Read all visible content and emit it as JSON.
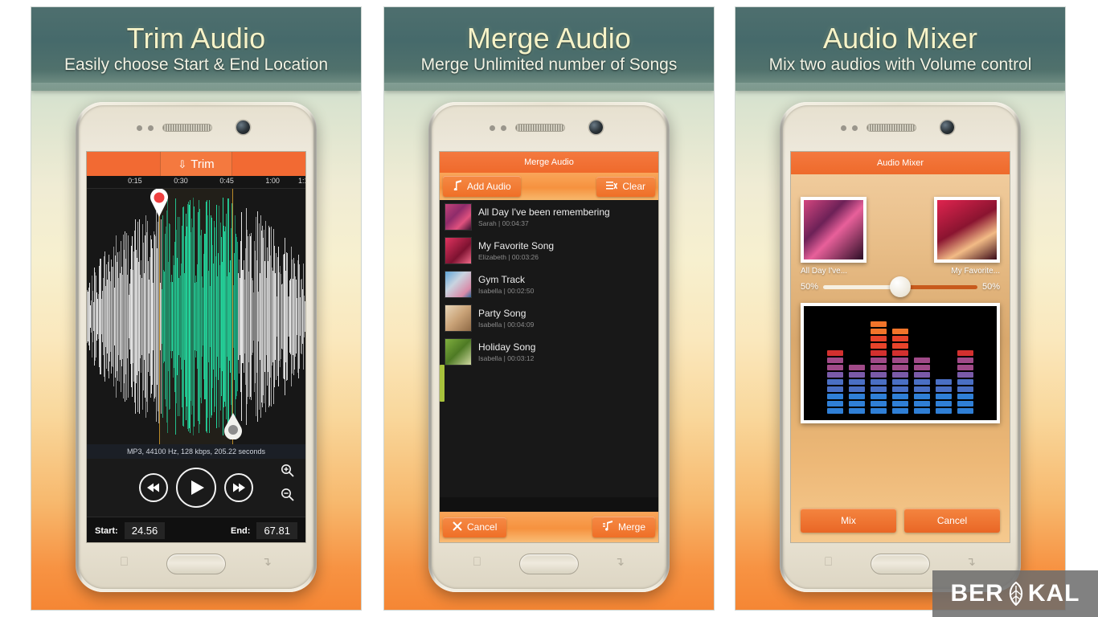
{
  "panels": [
    {
      "banner": {
        "title": "Trim Audio",
        "subtitle": "Easily choose Start & End Location"
      },
      "screen": {
        "trim_button_label": "Trim",
        "trim_icon": "collapse-arrows-icon",
        "ruler_labels": [
          "0:15",
          "0:30",
          "0:45",
          "1:00",
          "1:1"
        ],
        "meta": "MP3, 44100 Hz, 128 kbps, 205.22 seconds",
        "controls": {
          "rewind_label": "◀◀",
          "play_label": "▶",
          "forward_label": "▶▶",
          "zoom_in_label": "⊕",
          "zoom_out_label": "⊖"
        },
        "start_label": "Start:",
        "start_value": "24.56",
        "end_label": "End:",
        "end_value": "67.81"
      }
    },
    {
      "banner": {
        "title": "Merge Audio",
        "subtitle": "Merge Unlimited number of Songs"
      },
      "screen": {
        "title": "Merge Audio",
        "add_label": "Add Audio",
        "add_icon": "music-note-icon",
        "clear_label": "Clear",
        "clear_icon": "list-clear-icon",
        "songs": [
          {
            "name": "All Day I've been remembering",
            "artist": "Sarah",
            "duration": "00:04:37"
          },
          {
            "name": "My Favorite Song",
            "artist": "Elizabeth",
            "duration": "00:03:26"
          },
          {
            "name": "Gym Track",
            "artist": "Isabella",
            "duration": "00:02:50"
          },
          {
            "name": "Party Song",
            "artist": "Isabella",
            "duration": "00:04:09"
          },
          {
            "name": "Holiday Song",
            "artist": "Isabella",
            "duration": "00:03:12"
          }
        ],
        "cancel_label": "Cancel",
        "cancel_icon": "close-x-icon",
        "merge_label": "Merge",
        "merge_icon": "merge-notes-icon"
      }
    },
    {
      "banner": {
        "title": "Audio Mixer",
        "subtitle": "Mix two audios with Volume control"
      },
      "screen": {
        "title": "Audio Mixer",
        "left_track_label": "All Day I've...",
        "right_track_label": "My Favorite...",
        "left_percent": "50%",
        "right_percent": "50%",
        "mix_label": "Mix",
        "cancel_label": "Cancel",
        "equalizer_levels": [
          9,
          7,
          13,
          12,
          8,
          5,
          9
        ]
      }
    }
  ],
  "watermark": {
    "text_before": "BER",
    "text_after": "KAL",
    "icon": "leaf-brain-icon"
  },
  "colors": {
    "accent_orange": "#f26a33",
    "banner_green": "#4e6f6e",
    "banner_text": "#f6f3c8",
    "waveform_selected": "#19e0a8",
    "waveform_unselected": "#ffffff",
    "scroll_indicator": "#a8c23c"
  }
}
